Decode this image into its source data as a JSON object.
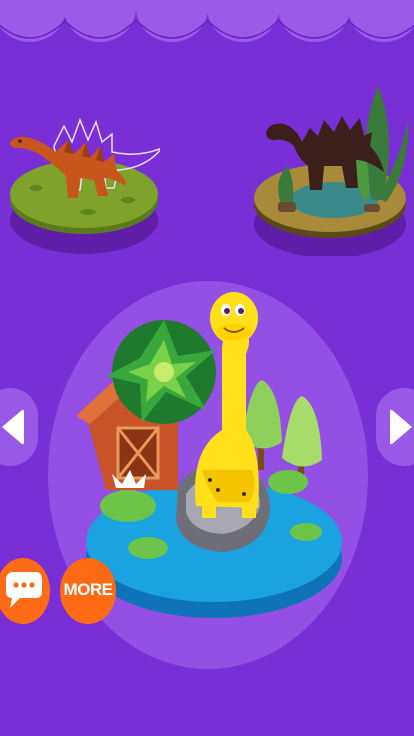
{
  "theme": {
    "background": "#7a2fd6",
    "scallop": "#9b5ae8",
    "stage_oval": "#9450e4",
    "button_orange": "#ff6a14",
    "pond_blue": "#1aa3e0",
    "dino_yellow": "#ffe01a"
  },
  "levels": [
    {
      "name": "stegosaurus-level",
      "state": "completed"
    },
    {
      "name": "silhouette-level",
      "state": "locked"
    }
  ],
  "stage": {
    "scene": "brachiosaurus-pond"
  },
  "nav": {
    "prev_icon": "triangle-left-icon",
    "next_icon": "triangle-right-icon"
  },
  "buttons": {
    "chat_icon": "speech-bubble-icon",
    "more_label": "MORE"
  }
}
